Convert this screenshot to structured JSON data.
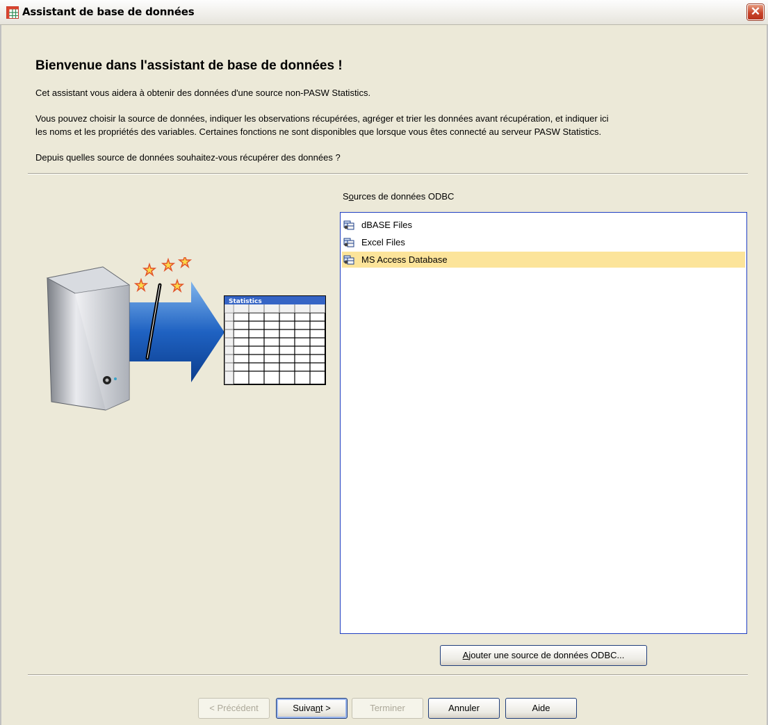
{
  "window": {
    "title": "Assistant de base de données",
    "close_icon": "close-icon",
    "app_icon": "grid-table-icon"
  },
  "header": {
    "title": "Bienvenue dans l'assistant de base de données !",
    "intro": "Cet assistant vous aidera à obtenir des données d'une source non-PASW Statistics.",
    "description_line1": "Vous pouvez choisir la source de données, indiquer les observations récupérées, agréger et trier les données avant récupération, et indiquer ici",
    "description_line2": "les noms et les propriétés des variables. Certaines fonctions ne sont disponibles que lorsque vous êtes connecté au serveur PASW Statistics.",
    "question": "Depuis quelles source de données souhaitez-vous récupérer des données ?"
  },
  "illustration": {
    "table_title": "Statistics"
  },
  "sources": {
    "label_prefix": "S",
    "label_underlined": "o",
    "label_rest": "urces de données ODBC",
    "items": [
      {
        "label": "dBASE Files",
        "icon": "odbc-datasource-icon",
        "selected": false
      },
      {
        "label": "Excel Files",
        "icon": "odbc-datasource-icon",
        "selected": false
      },
      {
        "label": "MS Access Database",
        "icon": "odbc-datasource-icon",
        "selected": true
      }
    ],
    "add_button_underlined": "A",
    "add_button_rest": "jouter une source de données ODBC..."
  },
  "footer": {
    "previous_label": "< Précédent",
    "next_prefix": "Suiva",
    "next_underlined": "n",
    "next_suffix": "t >",
    "finish_label": "Terminer",
    "cancel_label": "Annuler",
    "help_label": "Aide"
  },
  "colors": {
    "selection": "#fce49a",
    "listbox_border": "#1e3dc1",
    "dialog_bg": "#ece9d8",
    "close_button": "#c8442a"
  }
}
